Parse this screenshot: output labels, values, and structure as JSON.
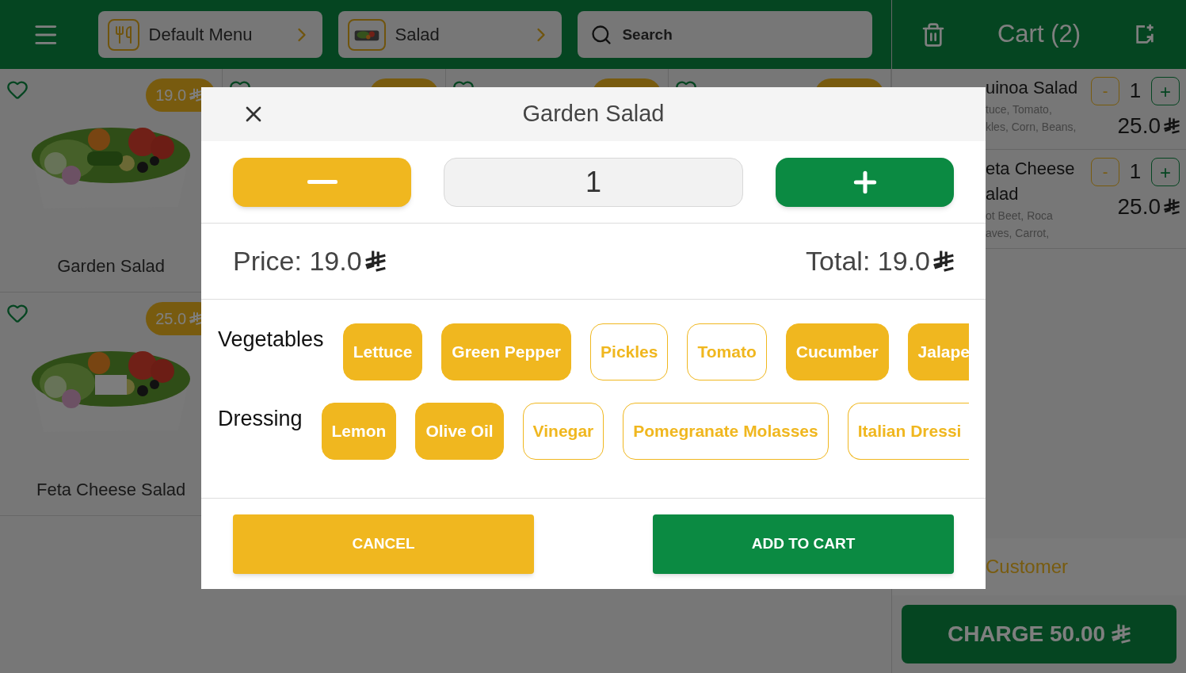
{
  "header": {
    "menu_chip": {
      "label": "Default Menu"
    },
    "category_chip": {
      "label": "Salad"
    },
    "search": {
      "placeholder": "Search"
    }
  },
  "products": [
    {
      "name": "Garden Salad",
      "price": "19.0"
    },
    {
      "name": "Feta Cheese Salad",
      "price": "25.0"
    }
  ],
  "cart": {
    "title": "Cart (2)",
    "items": [
      {
        "name_lines": [
          "uinoa Salad"
        ],
        "description_lines": [
          "tuce, Tomato,",
          "kles, Corn, Beans,"
        ],
        "minus": "-",
        "quantity": "1",
        "plus": "+",
        "price": "25.0"
      },
      {
        "name_lines": [
          "eta Cheese",
          "alad"
        ],
        "description_lines": [
          "ot Beet, Roca",
          "aves, Carrot,"
        ],
        "minus": "-",
        "quantity": "1",
        "plus": "+",
        "price": "25.0"
      }
    ],
    "customer": "Customer",
    "charge": "CHARGE 50.00"
  },
  "modal": {
    "title": "Garden Salad",
    "quantity": "1",
    "price_label": "Price:",
    "price": "19.0",
    "total_label": "Total:",
    "total": "19.0",
    "options": [
      {
        "label": "Vegetables",
        "items": [
          {
            "label": "Lettuce",
            "selected": true
          },
          {
            "label": "Green Pepper",
            "selected": true
          },
          {
            "label": "Pickles",
            "selected": false
          },
          {
            "label": "Tomato",
            "selected": false
          },
          {
            "label": "Cucumber",
            "selected": true
          },
          {
            "label": "Jalape",
            "selected": true
          }
        ]
      },
      {
        "label": "Dressing",
        "items": [
          {
            "label": "Lemon",
            "selected": true
          },
          {
            "label": "Olive Oil",
            "selected": true
          },
          {
            "label": "Vinegar",
            "selected": false
          },
          {
            "label": "Pomegranate Molasses",
            "selected": false
          },
          {
            "label": "Italian Dressi",
            "selected": false
          }
        ]
      }
    ],
    "cancel": "CANCEL",
    "add": "ADD TO CART"
  }
}
